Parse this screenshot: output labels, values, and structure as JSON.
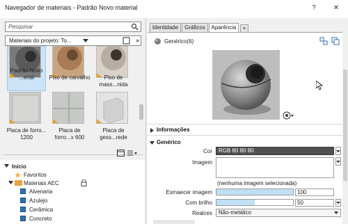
{
  "window": {
    "title": "Navegador de materiais - Padrão Novo material",
    "help_label": "?",
    "close_label": "✕"
  },
  "search": {
    "placeholder": "Pesquisar"
  },
  "library": {
    "header_label": "Materiais do projeto: To...",
    "more_label": "»"
  },
  "materials": [
    {
      "label": "Padrão Novo ...erial",
      "selected": true
    },
    {
      "label": "Piso de carvalho",
      "selected": false
    },
    {
      "label": "Piso de mass...nida",
      "selected": false
    },
    {
      "label": "Placa de forro... 1200",
      "selected": false
    },
    {
      "label": "Placa de forro...x 600",
      "selected": false
    },
    {
      "label": "Placa de gess...rede",
      "selected": false
    }
  ],
  "tree": {
    "root_label": "Início",
    "items": [
      {
        "label": "Favoritos",
        "kind": "star"
      },
      {
        "label": "Materiais AEC",
        "kind": "folder"
      },
      {
        "label": "Alvenaria",
        "kind": "material"
      },
      {
        "label": "Azulejo",
        "kind": "material"
      },
      {
        "label": "Cerâmica",
        "kind": "material"
      },
      {
        "label": "Concreto",
        "kind": "material"
      }
    ]
  },
  "tabs": [
    {
      "label": "Identidade",
      "active": false
    },
    {
      "label": "Gráficos",
      "active": false
    },
    {
      "label": "Aparência",
      "active": true
    },
    {
      "label": "+",
      "active": false
    }
  ],
  "asset": {
    "name": "Genérico(6)"
  },
  "sections": {
    "info": "Informações",
    "generic": "Genérico"
  },
  "properties": {
    "color_label": "Cor",
    "color_value": "RGB 80 80 80",
    "color_swatch": "#505050",
    "image_label": "Imagem",
    "image_note": "(nenhuma imagem selecionada)",
    "fade_label": "Esmaecer imagem",
    "fade_value": "100",
    "fade_fraction": 1.0,
    "gloss_label": "Com brilho",
    "gloss_value": "50",
    "gloss_fraction": 0.5,
    "highlights_label": "Realces",
    "highlights_value": "Não-metálico"
  },
  "colors": {
    "accent": "#cce4f7",
    "selection": "#9cc7ec",
    "folder": "#e8a23a",
    "material_icon": "#2f6fb7"
  }
}
